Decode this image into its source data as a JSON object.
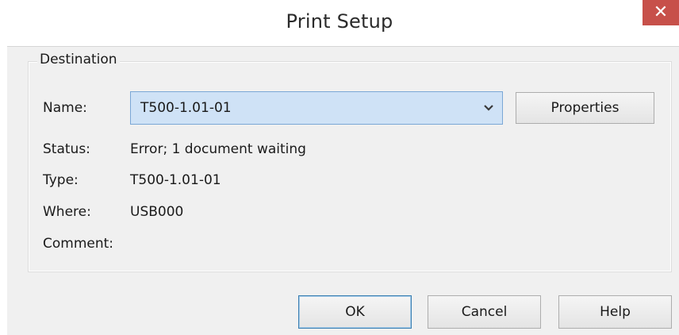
{
  "window": {
    "title": "Print Setup",
    "close_label": "✕"
  },
  "destination": {
    "group_label": "Destination",
    "name_label": "Name:",
    "name_value": "T500-1.01-01",
    "properties_label": "Properties",
    "status_label": "Status:",
    "status_value": "Error; 1 document waiting",
    "type_label": "Type:",
    "type_value": "T500-1.01-01",
    "where_label": "Where:",
    "where_value": "USB000",
    "comment_label": "Comment:",
    "comment_value": ""
  },
  "buttons": {
    "ok_label": "OK",
    "cancel_label": "Cancel",
    "help_label": "Help"
  },
  "colors": {
    "close_bg": "#c7504a",
    "combo_bg": "#cfe2f6",
    "combo_border": "#7aa7d6",
    "dialog_bg": "#f0f0f0"
  },
  "icons": {
    "dropdown": "chevron-down-icon",
    "close": "close-icon"
  }
}
